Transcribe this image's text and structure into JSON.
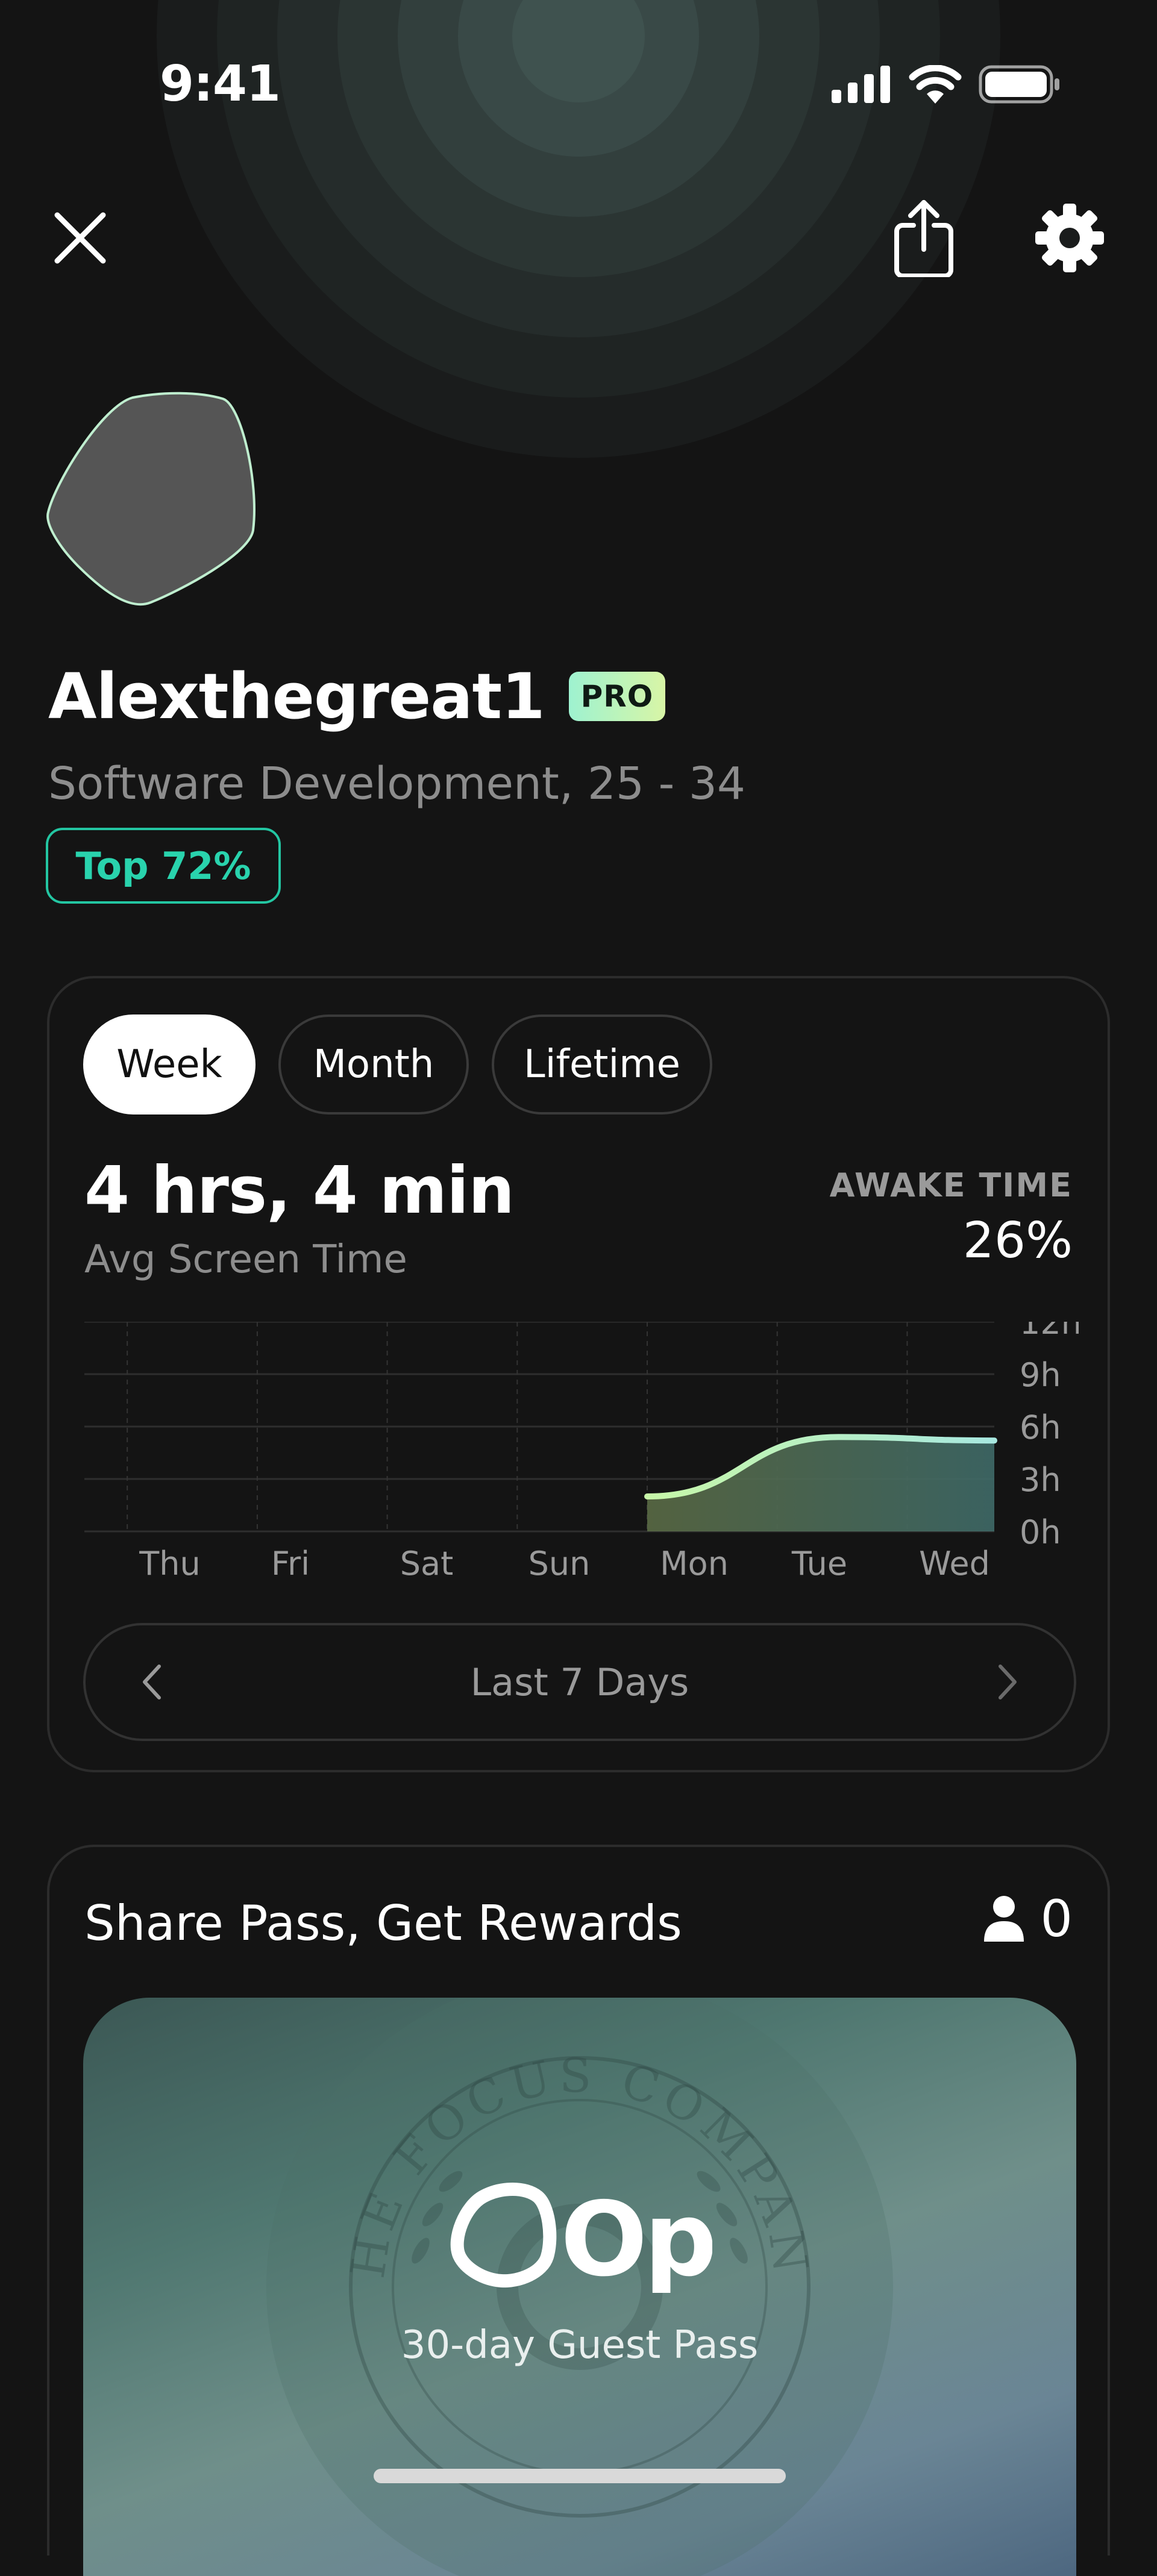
{
  "status_bar": {
    "time": "9:41"
  },
  "nav": {
    "close": "close-icon",
    "share": "share-icon",
    "settings": "gear-icon"
  },
  "profile": {
    "username": "Alexthegreat1",
    "badge": "PRO",
    "subtitle": "Software Development, 25 - 34",
    "rank": "Top 72%"
  },
  "stats": {
    "tabs": [
      {
        "label": "Week",
        "active": true
      },
      {
        "label": "Month",
        "active": false
      },
      {
        "label": "Lifetime",
        "active": false
      }
    ],
    "value": "4 hrs, 4 min",
    "value_label": "Avg Screen Time",
    "awake_label": "AWAKE TIME",
    "awake_value": "26%",
    "range_label": "Last 7 Days"
  },
  "chart_data": {
    "type": "area",
    "categories": [
      "Thu",
      "Fri",
      "Sat",
      "Sun",
      "Mon",
      "Tue",
      "Wed"
    ],
    "y_ticks": [
      "12h",
      "9h",
      "6h",
      "3h",
      "0h"
    ],
    "ylim": [
      0,
      12
    ],
    "series": [
      {
        "values": [
          null,
          null,
          null,
          null,
          2,
          5.4,
          5.2
        ]
      }
    ],
    "colors": {
      "line_start": "#c7f7a8",
      "line_end": "#a8e8e0",
      "fill_start": "#5a6b45",
      "fill_end": "#3f6a68"
    }
  },
  "rewards": {
    "title": "Share Pass, Get Rewards",
    "count": "0",
    "pass_logo": "Opal",
    "pass_subtitle": "30-day Guest Pass",
    "seal_text": "THE FOCUS COMPANY"
  },
  "colors": {
    "accent": "#29d3ad",
    "background": "#141414"
  }
}
